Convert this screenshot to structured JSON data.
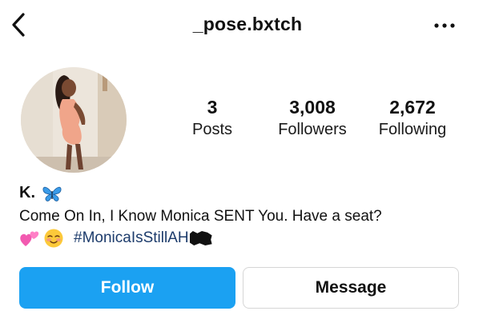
{
  "header": {
    "username": "_pose.bxtch",
    "back_icon": "chevron-left-icon",
    "more_icon": "more-horizontal-icon"
  },
  "profile": {
    "avatar": "profile-photo",
    "stats": {
      "posts_count": "3",
      "posts_label": "Posts",
      "followers_count": "3,008",
      "followers_label": "Followers",
      "following_count": "2,672",
      "following_label": "Following"
    }
  },
  "bio": {
    "name": "K.",
    "name_emoji": "butterfly-emoji",
    "line1": "Come On In, I Know Monica SENT You. Have a seat?",
    "line2_emojis": [
      "two-hearts-emoji",
      "smiling-blush-emoji"
    ],
    "hashtag": "#MonicaIsStillAH"
  },
  "actions": {
    "follow_label": "Follow",
    "message_label": "Message"
  },
  "colors": {
    "follow_button": "#1ba1f2",
    "hashtag": "#1c3b6b",
    "text": "#111111"
  }
}
